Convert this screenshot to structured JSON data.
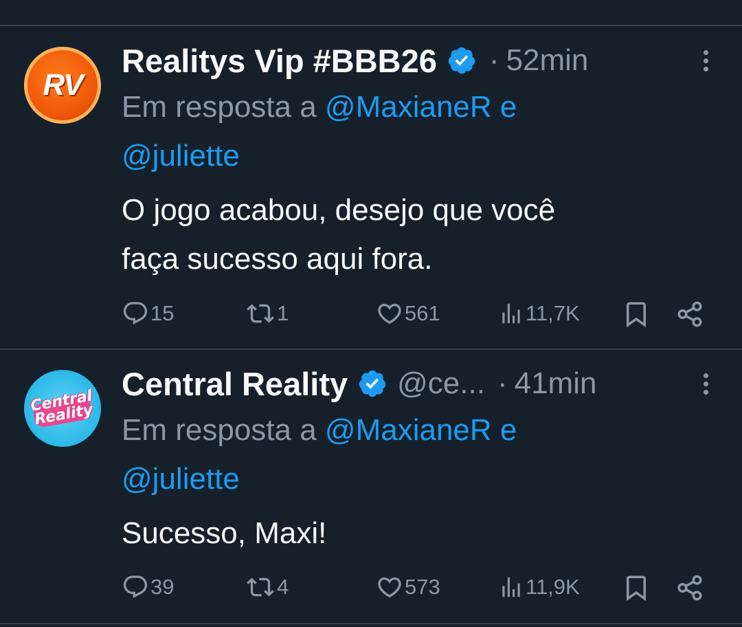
{
  "tweets": [
    {
      "author": "Realitys Vip #BBB26",
      "handle": "",
      "time": "52min",
      "avatar_label": "RV",
      "reply_prefix": "Em resposta a",
      "mention1": "@MaxianeR",
      "conj": "e",
      "mention2": "@juliette",
      "text_line1": "O jogo acabou, desejo que você",
      "text_line2": "faça sucesso aqui fora.",
      "stats": {
        "replies": "15",
        "retweets": "1",
        "likes": "561",
        "views": "11,7K"
      }
    },
    {
      "author": "Central Reality",
      "handle": "@ce...",
      "time": "41min",
      "avatar_label_1": "Central",
      "avatar_label_2": "Reality",
      "reply_prefix": "Em resposta a",
      "mention1": "@MaxianeR",
      "conj": "e",
      "mention2": "@juliette",
      "text_line1": "Sucesso, Maxi!",
      "stats": {
        "replies": "39",
        "retweets": "4",
        "likes": "573",
        "views": "11,9K"
      }
    }
  ],
  "icons": {
    "reply": "reply-icon",
    "retweet": "retweet-icon",
    "like": "heart-icon",
    "views": "views-icon",
    "bookmark": "bookmark-icon",
    "share": "share-icon",
    "more": "more-vertical-icon",
    "verified": "verified-badge-icon"
  },
  "colors": {
    "background": "#15202b",
    "text": "#f7f9f9",
    "muted": "#8b98a5",
    "link": "#1d9bf0",
    "divider": "#38444d"
  }
}
